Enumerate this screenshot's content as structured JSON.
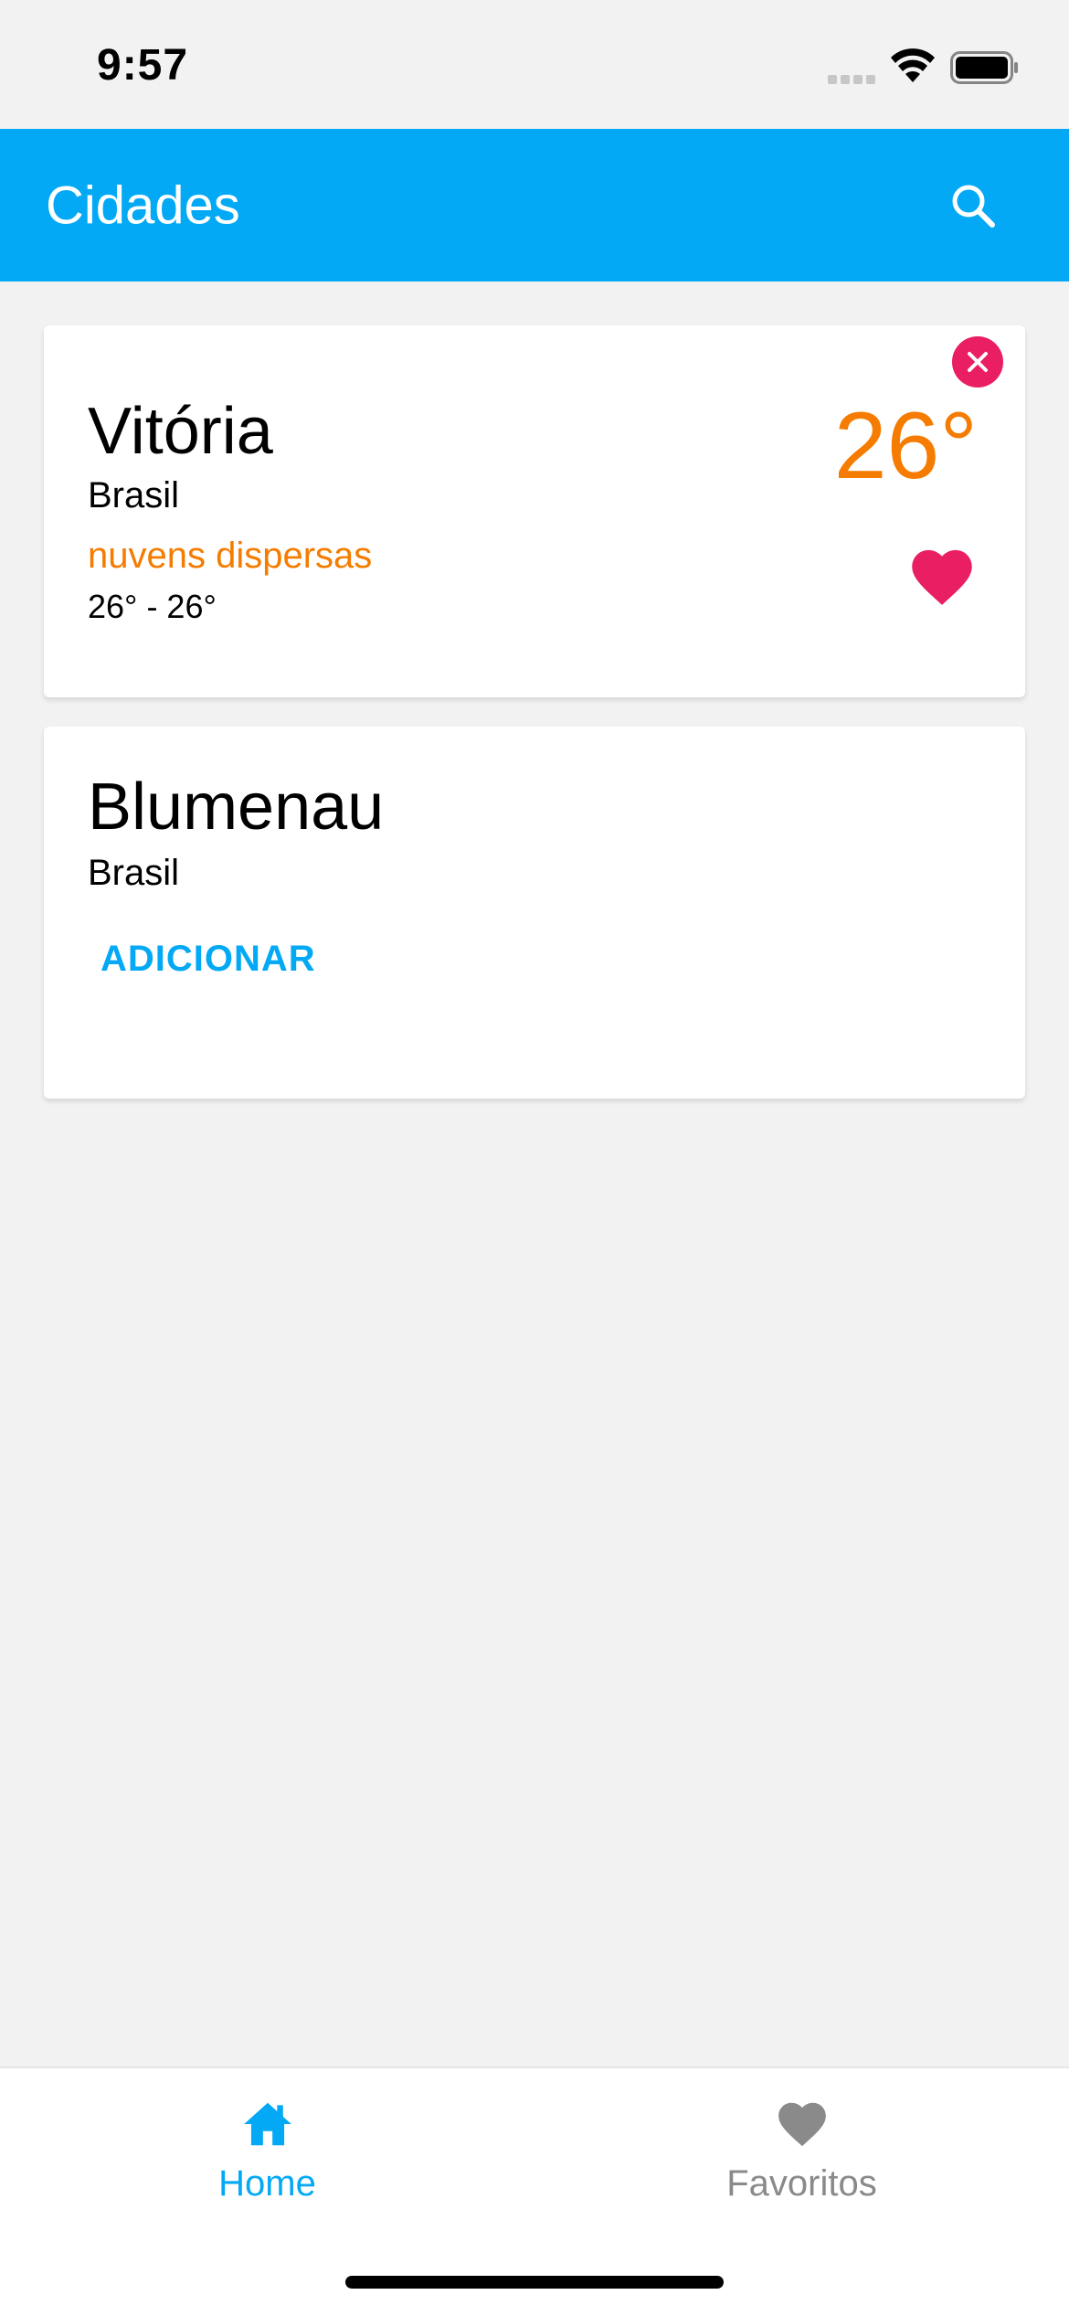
{
  "status_bar": {
    "time": "9:57"
  },
  "app_bar": {
    "title": "Cidades",
    "search_icon": "search-icon"
  },
  "cities": [
    {
      "name": "Vitória",
      "country": "Brasil",
      "condition": "nuvens dispersas",
      "range": "26° - 26°",
      "temperature": "26°",
      "is_favorite": true,
      "remove_icon": "close-icon",
      "favorite_icon": "heart-icon"
    },
    {
      "name": "Blumenau",
      "country": "Brasil",
      "add_label": "ADICIONAR"
    }
  ],
  "tab_bar": {
    "tabs": [
      {
        "label": "Home",
        "icon": "home-icon",
        "active": true
      },
      {
        "label": "Favoritos",
        "icon": "heart-icon",
        "active": false
      }
    ]
  },
  "colors": {
    "accent": "#03a9f4",
    "orange": "#f57c00",
    "pink": "#e91e63",
    "inactive": "#8a8a8a",
    "background": "#f2f2f2"
  }
}
